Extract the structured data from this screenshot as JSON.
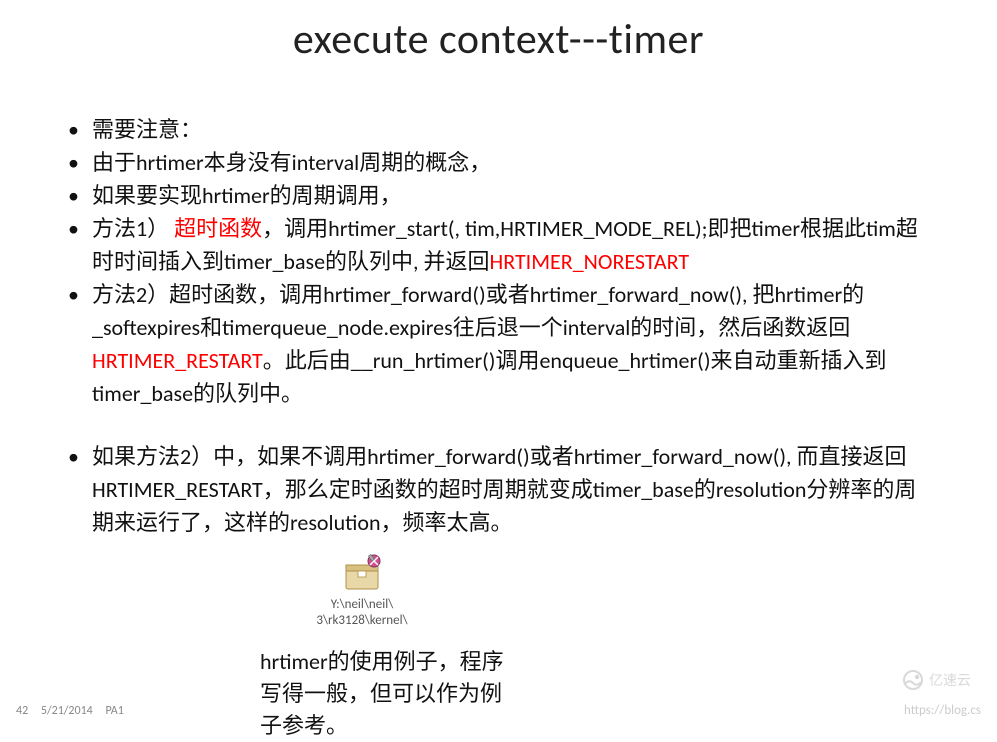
{
  "title": "execute context---timer",
  "bullets": {
    "b1": "需要注意：",
    "b2": "由于hrtimer本身没有interval周期的概念，",
    "b3": "如果要实现hrtimer的周期调用，",
    "b4_pre": "方法1）",
    "b4_red": "超时函数",
    "b4_mid": "，调用hrtimer_start(, tim,HRTIMER_MODE_REL);即把timer根据此tim超时时间插入到timer_base的队列中, 并返回",
    "b4_red2": "HRTIMER_NORESTART",
    "b5_pre": "方法2）超时函数，调用hrtimer_forward()或者hrtimer_forward_now(), 把hrtimer的_softexpires和timerqueue_node.expires往后退一个interval的时间，然后函数返回",
    "b5_red": "HRTIMER_RESTART",
    "b5_post": "。此后由__run_hrtimer()调用enqueue_hrtimer()来自动重新插入到timer_base的队列中。",
    "b6": "如果方法2）中，如果不调用hrtimer_forward()或者hrtimer_forward_now(), 而直接返回HRTIMER_RESTART，那么定时函数的超时周期就变成timer_base的resolution分辨率的周期来运行了，这样的resolution，频率太高。"
  },
  "file": {
    "path_line1": "Y:\\neil\\neil\\",
    "path_line2": "3\\rk3128\\kernel\\"
  },
  "bottom_note": "hrtimer的使用例子，程序写得一般，但可以作为例子参考。",
  "footer": {
    "page": "42",
    "date": "5/21/2014",
    "label": "PA1"
  },
  "watermark": {
    "url": "https://blog.cs",
    "brand": "亿速云"
  }
}
